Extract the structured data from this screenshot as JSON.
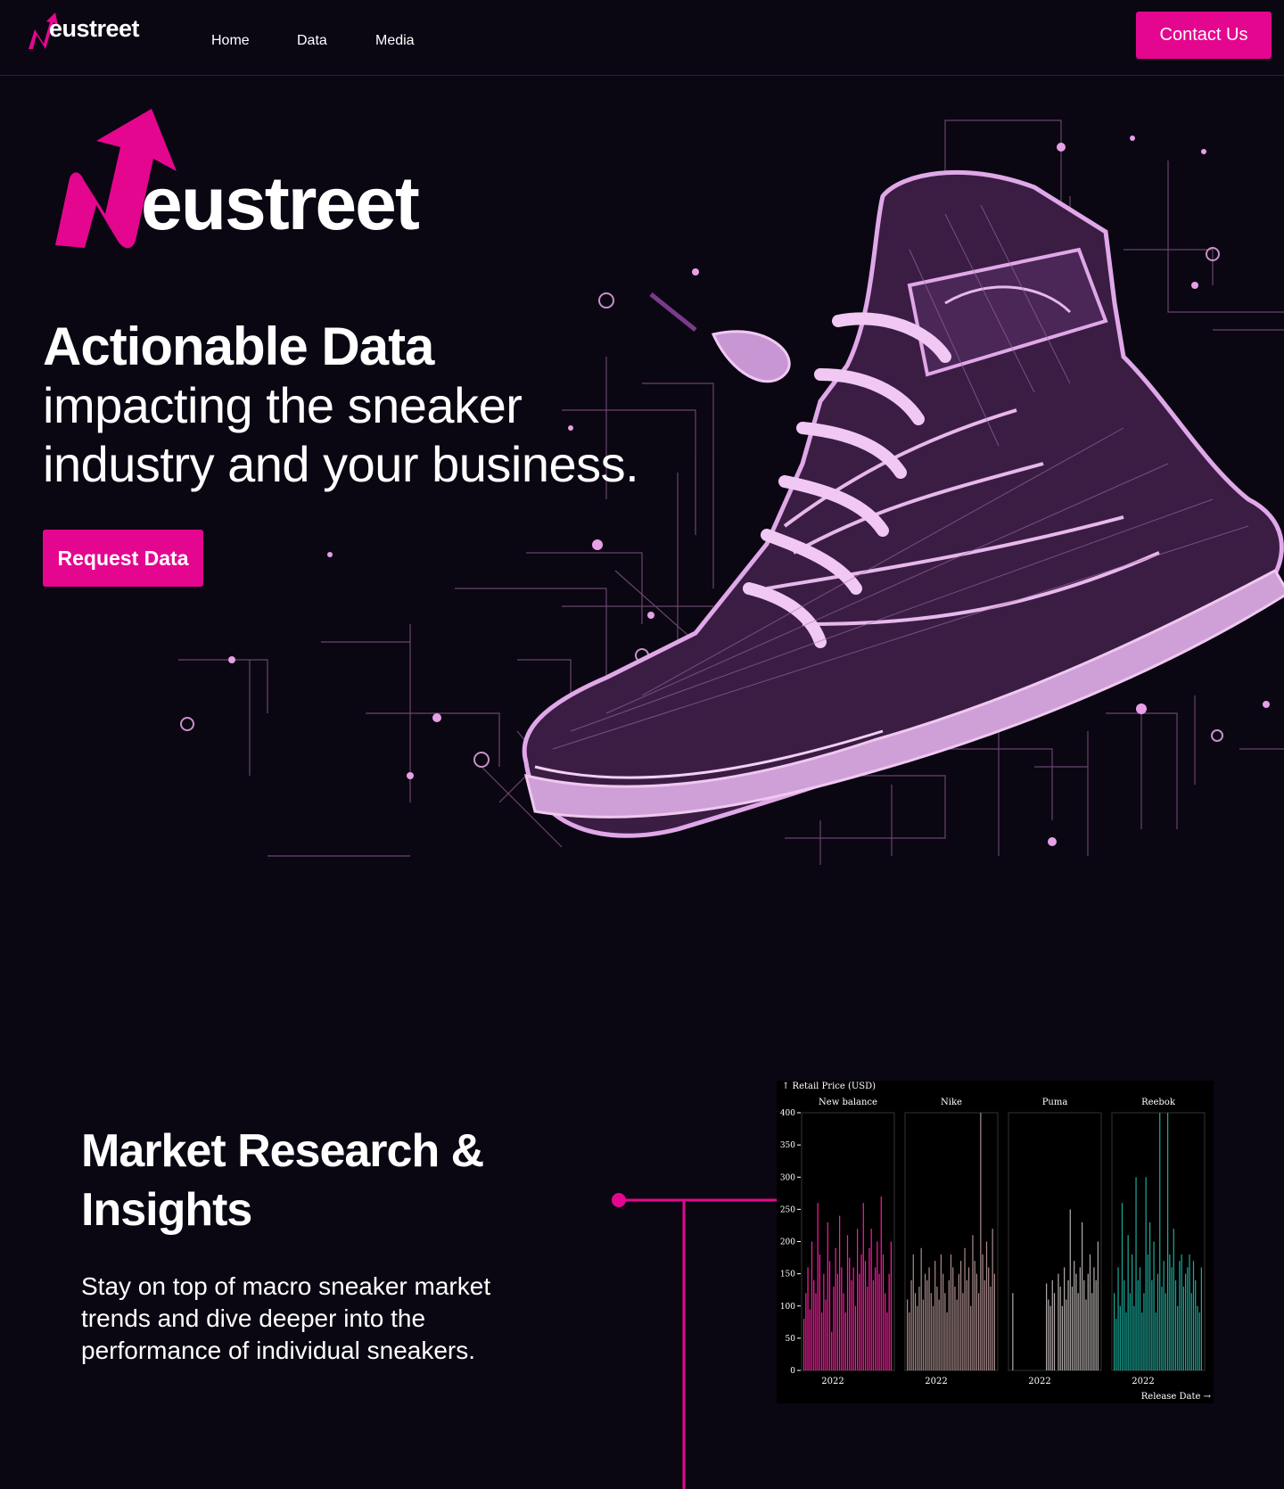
{
  "brand": {
    "name": "eustreet",
    "accent_color": "#e5068f",
    "background_color": "#0a0612"
  },
  "nav": {
    "links": [
      "Home",
      "Data",
      "Media"
    ],
    "contact_label": "Contact Us"
  },
  "hero": {
    "headline": "Actionable Data",
    "subline_1": "impacting the sneaker",
    "subline_2": "industry and your business.",
    "cta_label": "Request Data",
    "image": "sneaker-circuit-illustration"
  },
  "research": {
    "title_line_1": "Market Research &",
    "title_line_2": "Insights",
    "description": "Stay on top of macro sneaker market trends and dive deeper into the performance of individual sneakers."
  },
  "chart_data": {
    "type": "bar",
    "ylabel": "Retail Price (USD)",
    "xlabel": "Release Date",
    "ylim": [
      0,
      400
    ],
    "yticks": [
      0,
      50,
      100,
      150,
      200,
      250,
      300,
      350,
      400
    ],
    "grid": false,
    "panels": [
      {
        "name": "New balance",
        "xtick": "2022",
        "color": "#ff1aa0",
        "values": [
          80,
          120,
          160,
          95,
          200,
          140,
          120,
          260,
          180,
          90,
          150,
          110,
          230,
          170,
          60,
          130,
          190,
          150,
          240,
          160,
          120,
          90,
          210,
          175,
          140,
          160,
          100,
          220,
          150,
          180,
          260,
          170,
          130,
          190,
          220,
          140,
          160,
          200,
          150,
          270,
          180,
          120,
          90,
          150,
          200
        ]
      },
      {
        "name": "Nike",
        "xtick": "2022",
        "color": "#a88a8a",
        "values": [
          110,
          90,
          140,
          180,
          120,
          100,
          130,
          190,
          110,
          150,
          140,
          160,
          120,
          100,
          170,
          130,
          110,
          180,
          150,
          120,
          90,
          140,
          180,
          160,
          130,
          110,
          150,
          170,
          120,
          190,
          140,
          160,
          100,
          210,
          170,
          150,
          120,
          400,
          180,
          140,
          200,
          160,
          130,
          220,
          150
        ]
      },
      {
        "name": "Puma",
        "xtick": "2022",
        "color": "#b0a8a8",
        "values": [
          0,
          120,
          0,
          0,
          0,
          0,
          0,
          0,
          0,
          0,
          0,
          0,
          0,
          0,
          0,
          0,
          0,
          0,
          135,
          110,
          100,
          140,
          120,
          0,
          150,
          130,
          100,
          160,
          110,
          140,
          250,
          130,
          170,
          150,
          120,
          160,
          230,
          140,
          110,
          150,
          180,
          120,
          160,
          140,
          200
        ]
      },
      {
        "name": "Reebok",
        "xtick": "2022",
        "color": "#1aa898",
        "values": [
          120,
          80,
          160,
          100,
          260,
          140,
          90,
          210,
          120,
          180,
          100,
          300,
          140,
          160,
          90,
          120,
          300,
          180,
          230,
          140,
          200,
          90,
          150,
          400,
          130,
          170,
          120,
          400,
          180,
          160,
          220,
          140,
          100,
          170,
          180,
          130,
          150,
          160,
          180,
          120,
          170,
          140,
          100,
          90,
          160
        ]
      }
    ]
  }
}
